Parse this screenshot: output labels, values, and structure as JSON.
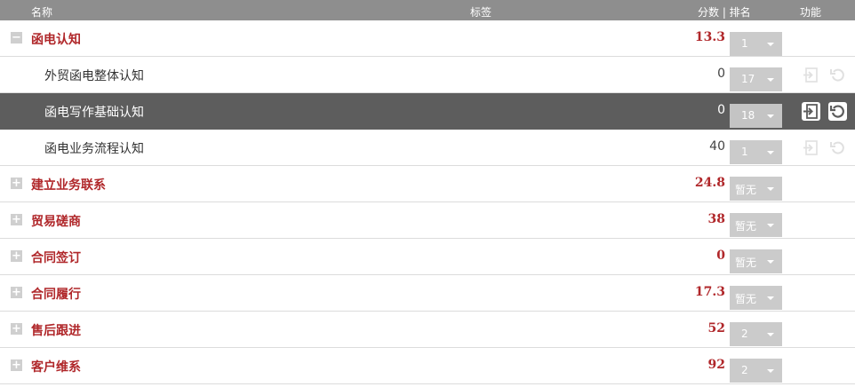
{
  "header": {
    "name": "名称",
    "tag": "标签",
    "score_rank": "分数 | 排名",
    "func": "功能"
  },
  "colors": {
    "accent": "#b0272a",
    "header_bg": "#8e8e8e",
    "selected_bg": "#5d5d5d",
    "rank_bg": "#cbcbcb"
  },
  "rows": [
    {
      "type": "parent",
      "toggle": "−",
      "name": "函电认知",
      "score": "13.3",
      "rank": "1"
    },
    {
      "type": "child",
      "name": "外贸函电整体认知",
      "score": "0",
      "rank": "17",
      "icons": [
        "enter-icon",
        "reset-icon"
      ]
    },
    {
      "type": "child",
      "selected": true,
      "name": "函电写作基础认知",
      "score": "0",
      "rank": "18",
      "icons": [
        "enter-icon",
        "reset-icon"
      ]
    },
    {
      "type": "child",
      "name": "函电业务流程认知",
      "score": "40",
      "rank": "1",
      "icons": [
        "enter-icon",
        "reset-icon"
      ]
    },
    {
      "type": "parent",
      "toggle": "+",
      "name": "建立业务联系",
      "score": "24.8",
      "rank": "暂无"
    },
    {
      "type": "parent",
      "toggle": "+",
      "name": "贸易磋商",
      "score": "38",
      "rank": "暂无"
    },
    {
      "type": "parent",
      "toggle": "+",
      "name": "合同签订",
      "score": "0",
      "rank": "暂无"
    },
    {
      "type": "parent",
      "toggle": "+",
      "name": "合同履行",
      "score": "17.3",
      "rank": "暂无"
    },
    {
      "type": "parent",
      "toggle": "+",
      "name": "售后跟进",
      "score": "52",
      "rank": "2"
    },
    {
      "type": "parent",
      "toggle": "+",
      "name": "客户维系",
      "score": "92",
      "rank": "2"
    }
  ]
}
